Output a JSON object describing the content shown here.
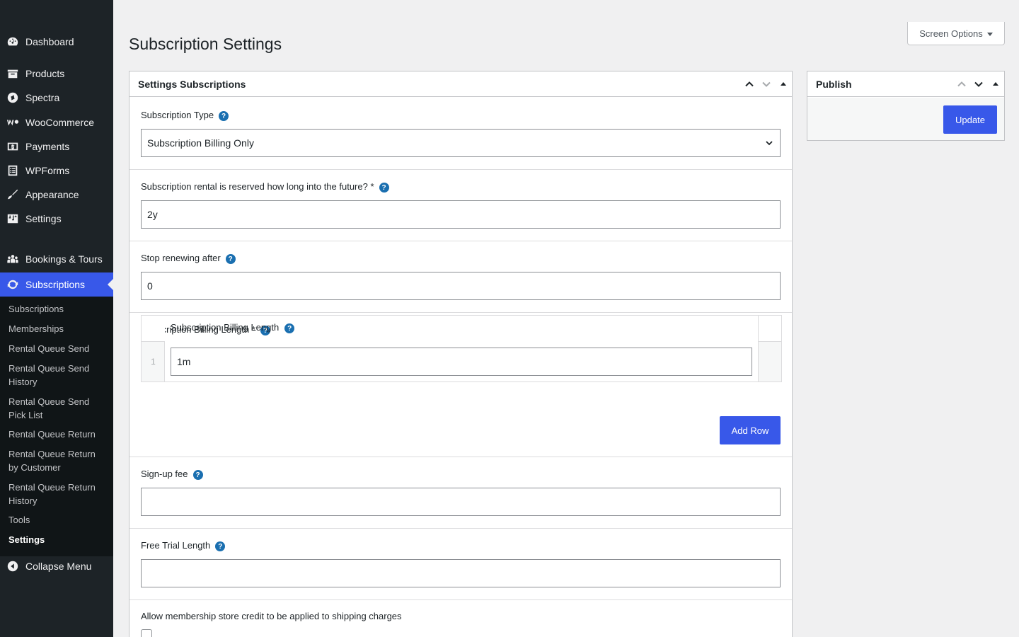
{
  "sidebar": {
    "items": [
      {
        "label": "Dashboard",
        "icon": "dashboard-icon"
      },
      {
        "label": "Products",
        "icon": "archive-icon"
      },
      {
        "label": "Spectra",
        "icon": "spectra-icon"
      },
      {
        "label": "WooCommerce",
        "icon": "woocommerce-icon"
      },
      {
        "label": "Payments",
        "icon": "payments-icon"
      },
      {
        "label": "WPForms",
        "icon": "wpforms-icon"
      },
      {
        "label": "Appearance",
        "icon": "brush-icon"
      },
      {
        "label": "Settings",
        "icon": "settings-icon"
      },
      {
        "label": "Bookings & Tours",
        "icon": "groups-icon"
      },
      {
        "label": "Subscriptions",
        "icon": "update-icon"
      }
    ],
    "submenu": [
      "Subscriptions",
      "Memberships",
      "Rental Queue Send",
      "Rental Queue Send History",
      "Rental Queue Send Pick List",
      "Rental Queue Return",
      "Rental Queue Return by Customer",
      "Rental Queue Return History",
      "Tools",
      "Settings"
    ],
    "collapse_label": "Collapse Menu"
  },
  "header": {
    "title": "Subscription Settings",
    "screen_options": "Screen Options"
  },
  "settings_box": {
    "title": "Settings Subscriptions",
    "fields": {
      "subscription_type": {
        "label": "Subscription Type",
        "value": "Subscription Billing Only"
      },
      "reserve_future": {
        "label": "Subscription rental is reserved how long into the future? *",
        "value": "2y"
      },
      "stop_renewing": {
        "label": "Stop renewing after",
        "value": "0"
      },
      "billing_length": {
        "label": "Subscription Billing Length *",
        "column_label": "Subscription Billing Length",
        "rows": [
          {
            "num": "1",
            "value": "1m"
          }
        ],
        "add_row": "Add Row"
      },
      "signup_fee": {
        "label": "Sign-up fee",
        "value": ""
      },
      "free_trial": {
        "label": "Free Trial Length",
        "value": ""
      },
      "store_credit": {
        "label": "Allow membership store credit to be applied to shipping charges"
      }
    }
  },
  "publish_box": {
    "title": "Publish",
    "update": "Update"
  },
  "colors": {
    "accent": "#3858e9",
    "sidebar_bg": "#1d2327",
    "help": "#1a6fb0"
  }
}
